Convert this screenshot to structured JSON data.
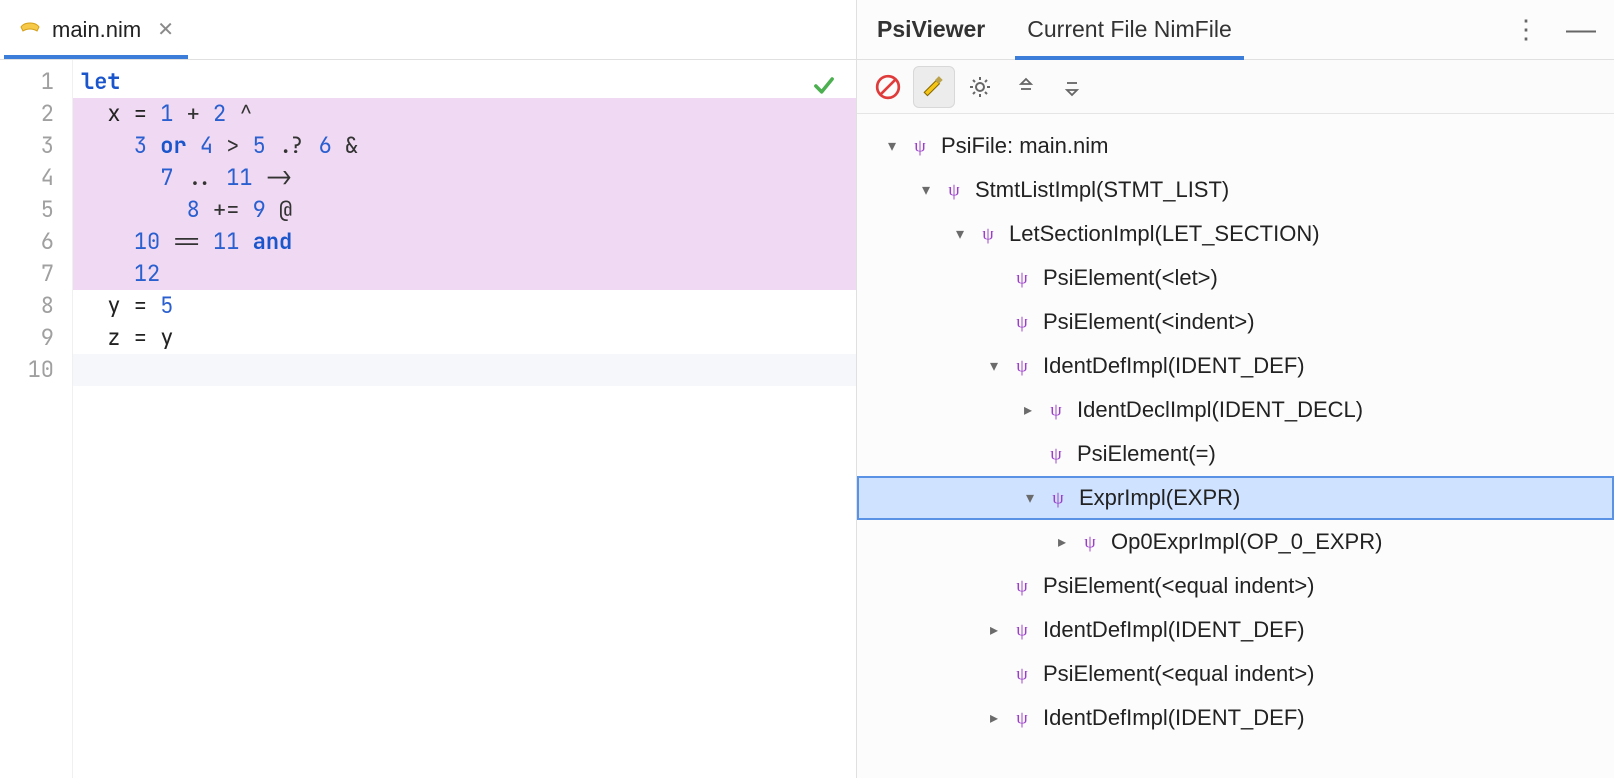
{
  "editor": {
    "file_tab": {
      "name": "main.nim"
    },
    "lines": [
      "1",
      "2",
      "3",
      "4",
      "5",
      "6",
      "7",
      "8",
      "9",
      "10"
    ],
    "code": {
      "l1": {
        "kw": "let"
      },
      "l2": {
        "pre": "  x = ",
        "n1": "1",
        "op1": " + ",
        "n2": "2",
        "op2": " ^"
      },
      "l3": {
        "pre": "    ",
        "n1": "3",
        "kw1": " or ",
        "n2": "4",
        "op1": " > ",
        "n3": "5",
        "op2": " .? ",
        "n4": "6",
        "op3": " &"
      },
      "l4": {
        "pre": "      ",
        "n1": "7",
        "op1": " .. ",
        "n2": "11",
        "op2": " ->"
      },
      "l5": {
        "pre": "        ",
        "n1": "8",
        "op1": " += ",
        "n2": "9",
        "op2": " @"
      },
      "l6": {
        "pre": "    ",
        "n1": "10",
        "op1": " == ",
        "n2": "11",
        "kw1": " and"
      },
      "l7": {
        "pre": "    ",
        "n1": "12"
      },
      "l8": {
        "pre": "  y = ",
        "n1": "5"
      },
      "l9": {
        "pre": "  z = y"
      }
    }
  },
  "side": {
    "tabs": {
      "psi": "PsiViewer",
      "file": "Current File NimFile"
    },
    "toolbar_icons": [
      "stop-icon",
      "brush-icon",
      "gear-icon",
      "collapse-icon",
      "expand-icon"
    ],
    "tree": [
      {
        "depth": 0,
        "arrow": "down",
        "label": "PsiFile: main.nim"
      },
      {
        "depth": 1,
        "arrow": "down",
        "label": "StmtListImpl(STMT_LIST)"
      },
      {
        "depth": 2,
        "arrow": "down",
        "label": "LetSectionImpl(LET_SECTION)"
      },
      {
        "depth": 3,
        "arrow": "none",
        "label": "PsiElement(<let>)"
      },
      {
        "depth": 3,
        "arrow": "none",
        "label": "PsiElement(<indent>)"
      },
      {
        "depth": 3,
        "arrow": "down",
        "label": "IdentDefImpl(IDENT_DEF)"
      },
      {
        "depth": 4,
        "arrow": "right",
        "label": "IdentDeclImpl(IDENT_DECL)"
      },
      {
        "depth": 4,
        "arrow": "none",
        "label": "PsiElement(=)"
      },
      {
        "depth": 4,
        "arrow": "down",
        "label": "ExprImpl(EXPR)",
        "selected": true
      },
      {
        "depth": 5,
        "arrow": "right",
        "label": "Op0ExprImpl(OP_0_EXPR)"
      },
      {
        "depth": 3,
        "arrow": "none",
        "label": "PsiElement(<equal indent>)"
      },
      {
        "depth": 3,
        "arrow": "right",
        "label": "IdentDefImpl(IDENT_DEF)"
      },
      {
        "depth": 3,
        "arrow": "none",
        "label": "PsiElement(<equal indent>)"
      },
      {
        "depth": 3,
        "arrow": "right",
        "label": "IdentDefImpl(IDENT_DEF)"
      }
    ]
  }
}
